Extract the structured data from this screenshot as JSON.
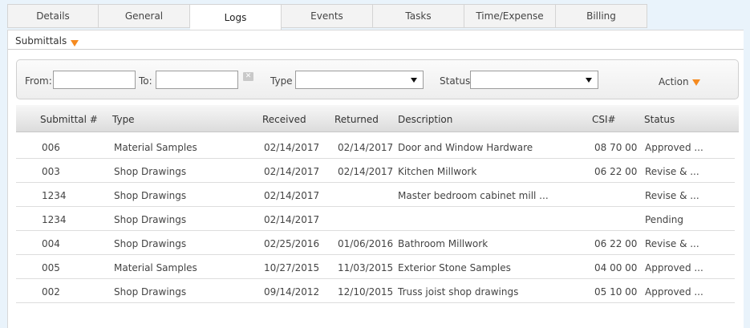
{
  "tabs": [
    "Details",
    "General",
    "Logs",
    "Events",
    "Tasks",
    "Time/Expense",
    "Billing"
  ],
  "active_tab": "Logs",
  "section": {
    "label": "Submittals"
  },
  "filters": {
    "from_label": "From:",
    "to_label": "To:",
    "type_label": "Type",
    "status_label": "Status",
    "action_label": "Action",
    "from_value": "",
    "to_value": "",
    "type_value": "",
    "status_value": ""
  },
  "table": {
    "columns": [
      "Submittal #",
      "Type",
      "Received",
      "Returned",
      "Description",
      "CSI#",
      "Status"
    ],
    "rows": [
      [
        "006",
        "Material Samples",
        "02/14/2017",
        "02/14/2017",
        "Door and Window Hardware",
        "08 70 00",
        "Approved ..."
      ],
      [
        "003",
        "Shop Drawings",
        "02/14/2017",
        "02/14/2017",
        "Kitchen Millwork",
        "06 22 00",
        "Revise & ..."
      ],
      [
        "1234",
        "Shop Drawings",
        "02/14/2017",
        "",
        "Master bedroom cabinet mill ...",
        "",
        "Revise & ..."
      ],
      [
        "1234",
        "Shop Drawings",
        "02/14/2017",
        "",
        "",
        "",
        "Pending"
      ],
      [
        "004",
        "Shop Drawings",
        "02/25/2016",
        "01/06/2016",
        "Bathroom Millwork",
        "06 22 00",
        "Revise & ..."
      ],
      [
        "005",
        "Material Samples",
        "10/27/2015",
        "11/03/2015",
        "Exterior Stone Samples",
        "04 00 00",
        "Approved ..."
      ],
      [
        "002",
        "Shop Drawings",
        "09/14/2012",
        "12/10/2015",
        "Truss joist shop drawings",
        "05 10 00",
        "Approved ..."
      ]
    ]
  },
  "colors": {
    "accent": "#f58a1f",
    "page_bg": "#e9f3fb"
  }
}
